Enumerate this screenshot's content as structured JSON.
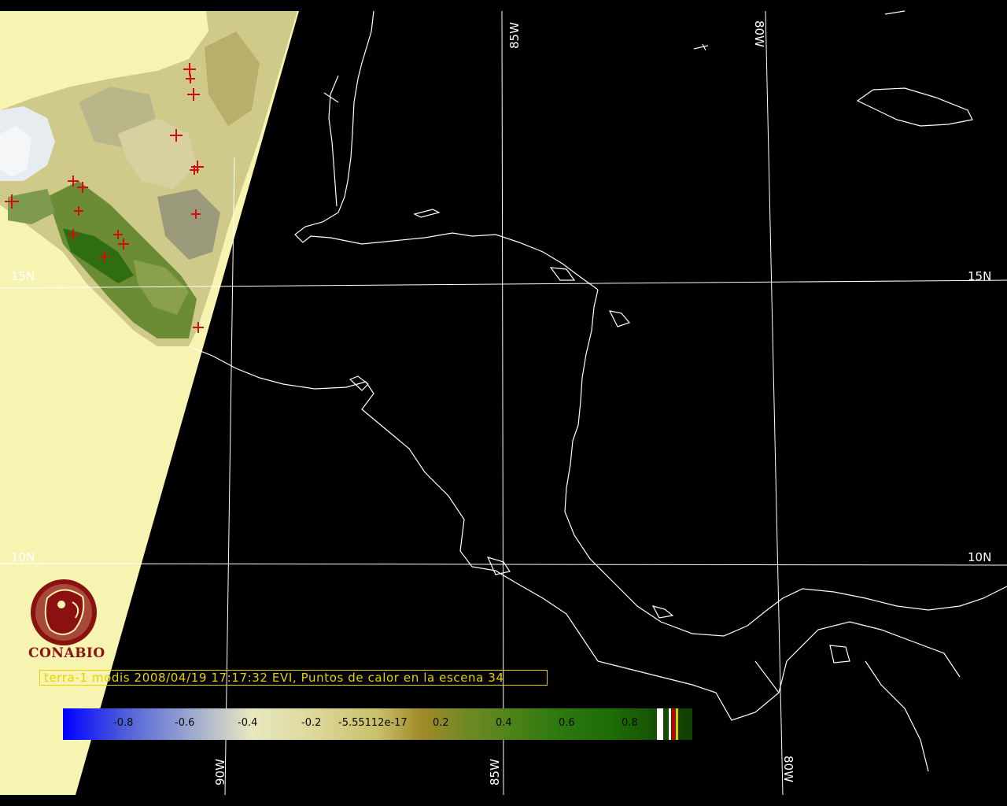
{
  "map": {
    "grid_labels": {
      "lon_85w_top": "85W",
      "lon_80w_top": "80W",
      "lat_15n_left": "15N",
      "lat_15n_right": "15N",
      "lat_10n_left": "10N",
      "lat_10n_right": "10N",
      "lon_90w_bottom": "90W",
      "lon_85w_bottom": "85W",
      "lon_80w_bottom": "80W"
    },
    "colors": {
      "background": "#000000",
      "coastline": "#ffffff",
      "gridline": "#ffffff",
      "swath": "#f6f4b0",
      "hotspot": "#d01010",
      "caption": "#e8d000",
      "logo": "#8b1111"
    }
  },
  "caption": {
    "text": "terra-1 modis 2008/04/19 17:17:32 EVI, Puntos de calor en la escena 34"
  },
  "colorbar": {
    "ticks": [
      "-0.8",
      "-0.6",
      "-0.4",
      "-0.2",
      "-5.55112e-17",
      "0.2",
      "0.4",
      "0.6",
      "0.8"
    ]
  },
  "logo": {
    "text": "CONABIO",
    "icon": "macaw-emblem-icon"
  }
}
